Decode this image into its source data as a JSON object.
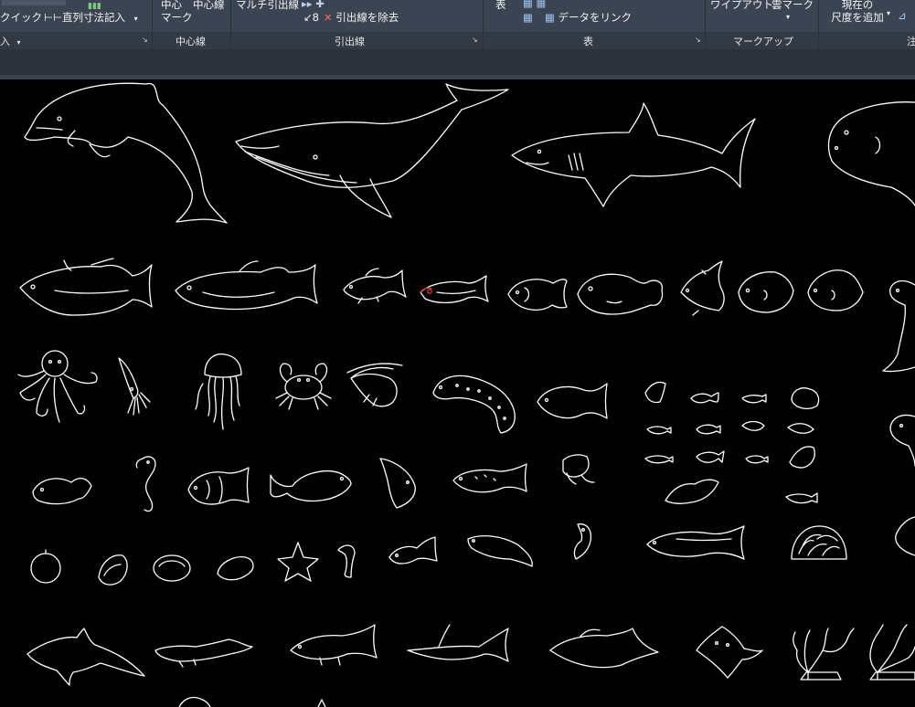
{
  "ribbon": {
    "dimension_panel": {
      "quick_label": "クイック",
      "continue_label": "直列寸法記入",
      "title": "入"
    },
    "centerline_panel": {
      "center_mark_line1": "中心",
      "center_mark_line2": "マーク",
      "center_line_label": "中心線",
      "title": "中心線"
    },
    "leader_panel": {
      "multileader_label": "マルチ引出線",
      "remove_leader_label": "引出線を除去",
      "title": "引出線"
    },
    "table_panel": {
      "table_label": "表",
      "link_data_label": "データをリンク",
      "title": "表"
    },
    "markup_panel": {
      "wipeout_label": "ワイプアウト",
      "revcloud_label": "雲マーク",
      "title": "マークアップ"
    },
    "annotation_scale_panel": {
      "add_current_line1": "現在の",
      "add_current_line2": "尺度を追加",
      "title": "注"
    }
  },
  "canvas": {
    "background": "#000000",
    "stroke_color": "#ffffff",
    "highlight_color": "#e03030"
  }
}
